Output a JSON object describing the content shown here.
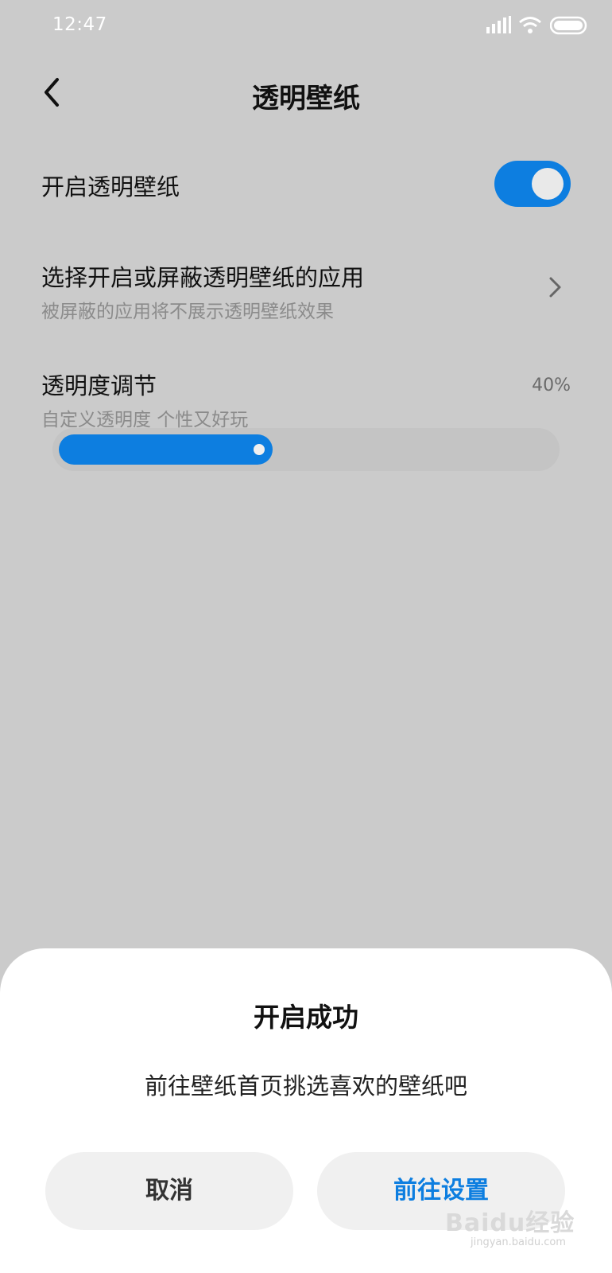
{
  "status_bar": {
    "time": "12:47",
    "icons": [
      "signal-icon",
      "wifi-icon",
      "battery-icon"
    ]
  },
  "header": {
    "title": "透明壁纸",
    "back_icon": "back-arrow-icon"
  },
  "settings": {
    "enable": {
      "label": "开启透明壁纸",
      "enabled": true
    },
    "apps": {
      "label": "选择开启或屏蔽透明壁纸的应用",
      "sublabel": "被屏蔽的应用将不展示透明壁纸效果",
      "icon": "chevron-right-icon"
    },
    "transparency": {
      "label": "透明度调节",
      "sublabel": "自定义透明度 个性又好玩",
      "value_text": "40%",
      "value": 40
    }
  },
  "dialog": {
    "title": "开启成功",
    "message": "前往壁纸首页挑选喜欢的壁纸吧",
    "cancel_label": "取消",
    "confirm_label": "前往设置"
  },
  "watermark": {
    "text": "Baidu经验",
    "sub": "jingyan.baidu.com"
  },
  "colors": {
    "accent": "#0d7ee0",
    "background": "#cbcbcb",
    "sheet": "#ffffff"
  }
}
